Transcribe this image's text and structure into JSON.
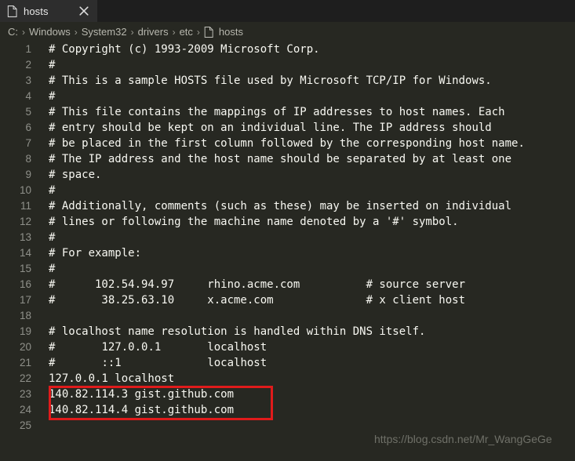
{
  "window": {
    "title": "hosts",
    "background_color": "#272822",
    "accent_color": "#e01b1b"
  },
  "tabbar": {
    "tabs": [
      {
        "label": "hosts",
        "icon": "file-icon",
        "close_icon": "close-icon",
        "active": true
      }
    ]
  },
  "breadcrumb": {
    "separator": "›",
    "items": [
      {
        "label": "C:",
        "icon": ""
      },
      {
        "label": "Windows",
        "icon": ""
      },
      {
        "label": "System32",
        "icon": ""
      },
      {
        "label": "drivers",
        "icon": ""
      },
      {
        "label": "etc",
        "icon": ""
      },
      {
        "label": "hosts",
        "icon": "file-icon"
      }
    ]
  },
  "editor": {
    "first_line_number": 1,
    "lines": [
      {
        "n": "1",
        "text": "# Copyright (c) 1993-2009 Microsoft Corp."
      },
      {
        "n": "2",
        "text": "#"
      },
      {
        "n": "3",
        "text": "# This is a sample HOSTS file used by Microsoft TCP/IP for Windows."
      },
      {
        "n": "4",
        "text": "#"
      },
      {
        "n": "5",
        "text": "# This file contains the mappings of IP addresses to host names. Each"
      },
      {
        "n": "6",
        "text": "# entry should be kept on an individual line. The IP address should"
      },
      {
        "n": "7",
        "text": "# be placed in the first column followed by the corresponding host name."
      },
      {
        "n": "8",
        "text": "# The IP address and the host name should be separated by at least one"
      },
      {
        "n": "9",
        "text": "# space."
      },
      {
        "n": "10",
        "text": "#"
      },
      {
        "n": "11",
        "text": "# Additionally, comments (such as these) may be inserted on individual"
      },
      {
        "n": "12",
        "text": "# lines or following the machine name denoted by a '#' symbol."
      },
      {
        "n": "13",
        "text": "#"
      },
      {
        "n": "14",
        "text": "# For example:"
      },
      {
        "n": "15",
        "text": "#"
      },
      {
        "n": "16",
        "text": "#      102.54.94.97     rhino.acme.com          # source server"
      },
      {
        "n": "17",
        "text": "#       38.25.63.10     x.acme.com              # x client host"
      },
      {
        "n": "18",
        "text": ""
      },
      {
        "n": "19",
        "text": "# localhost name resolution is handled within DNS itself."
      },
      {
        "n": "20",
        "text": "#\t127.0.0.1       localhost"
      },
      {
        "n": "21",
        "text": "#\t::1             localhost"
      },
      {
        "n": "22",
        "text": "127.0.0.1 localhost"
      },
      {
        "n": "23",
        "text": "140.82.114.3 gist.github.com"
      },
      {
        "n": "24",
        "text": "140.82.114.4 gist.github.com"
      },
      {
        "n": "25",
        "text": ""
      }
    ]
  },
  "annotation": {
    "highlight_box": {
      "color": "#e01b1b",
      "covers_lines": [
        "23",
        "24"
      ]
    }
  },
  "watermark": {
    "text": "https://blog.csdn.net/Mr_WangGeGe"
  }
}
